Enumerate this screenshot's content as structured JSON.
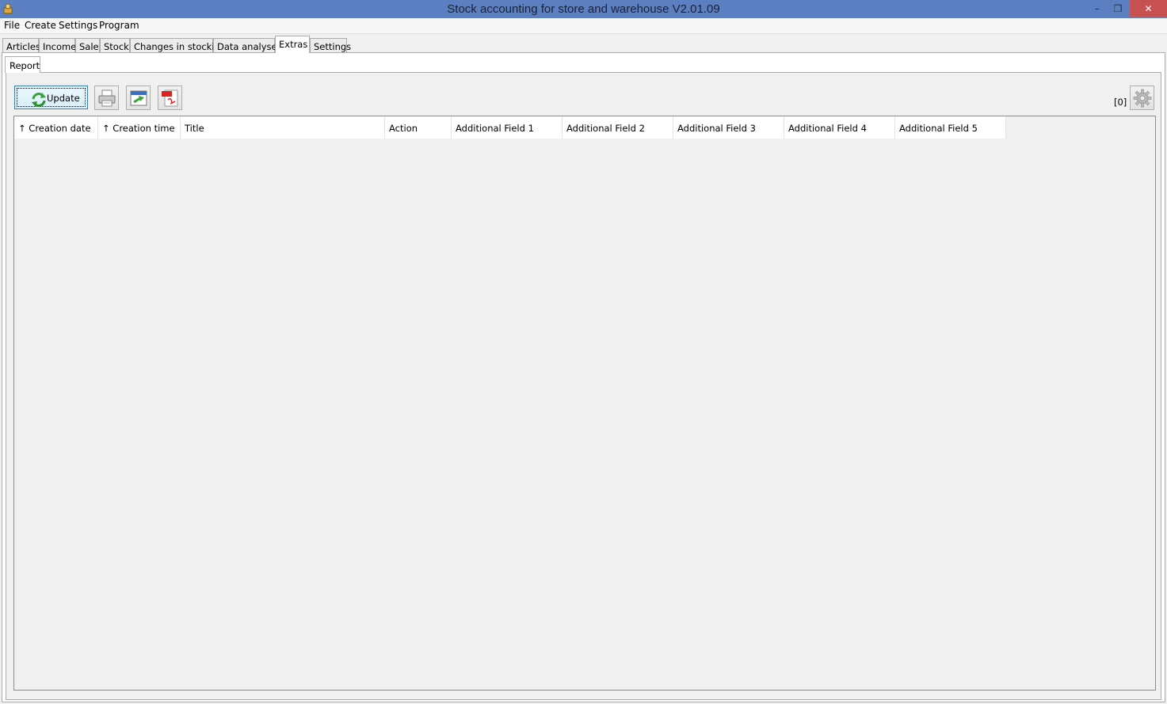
{
  "window": {
    "title": "Stock accounting for store and warehouse V2.01.09",
    "minimize_glyph": "–",
    "maximize_glyph": "❐",
    "close_glyph": "✕"
  },
  "menu": [
    "File",
    "Create",
    "Settings",
    "Program"
  ],
  "tabs": [
    "Articles",
    "Income",
    "Sale",
    "Stock",
    "Changes in stocking",
    "Data analyses",
    "Extras",
    "Settings"
  ],
  "active_tab": "Extras",
  "subtab": "Report",
  "toolbar": {
    "update_label": "Update",
    "count_label": "[0]"
  },
  "table": {
    "columns": [
      "↑ Creation date",
      "↑ Creation time",
      "Title",
      "Action",
      "Additional Field 1",
      "Additional Field 2",
      "Additional Field 3",
      "Additional Field 4",
      "Additional Field 5"
    ],
    "rows": []
  },
  "colors": {
    "titlebar": "#5b7fc0",
    "close_button": "#c75050"
  }
}
